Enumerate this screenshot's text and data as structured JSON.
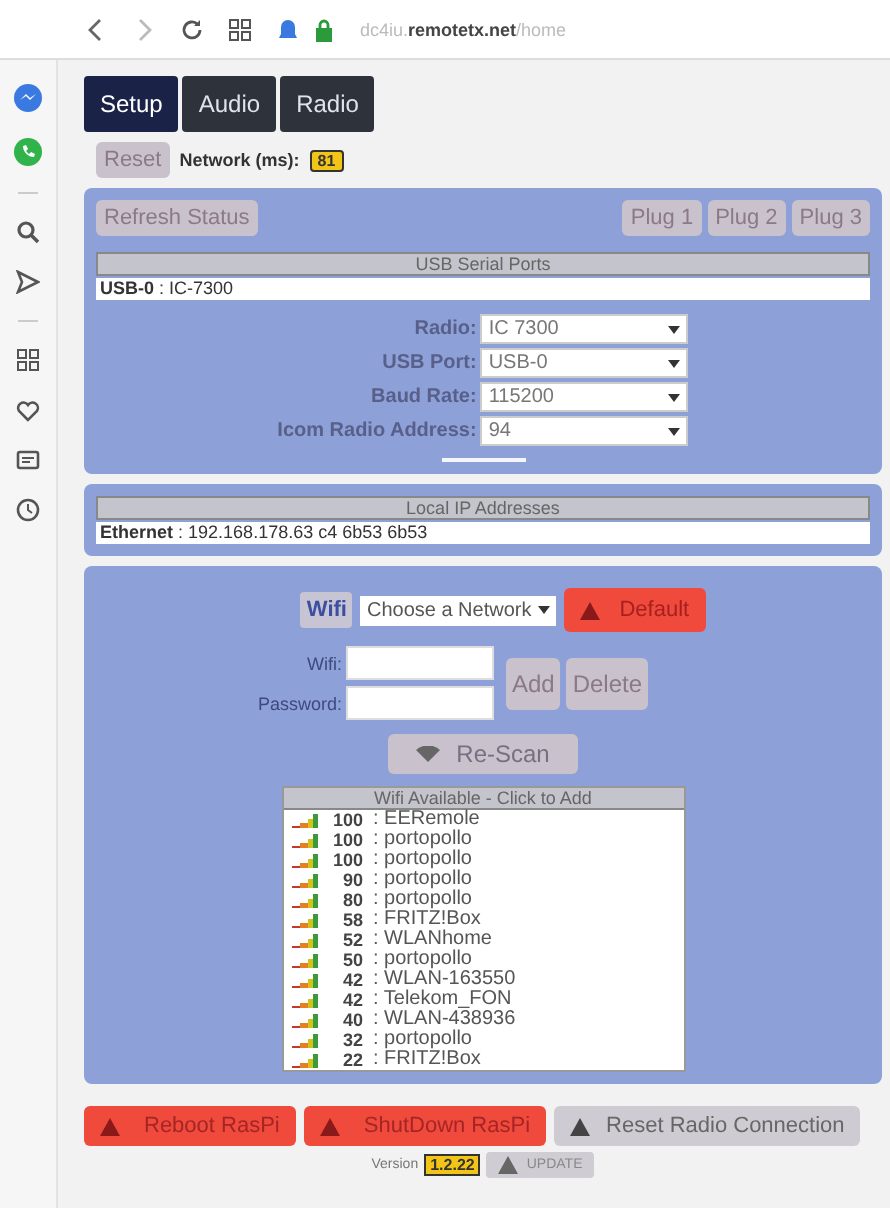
{
  "browser": {
    "url_host": "dc4iu.",
    "url_domain": "remotetx.net",
    "url_path": "/home"
  },
  "tabs": [
    {
      "label": "Setup",
      "selected": true
    },
    {
      "label": "Audio",
      "selected": false
    },
    {
      "label": "Radio",
      "selected": false
    }
  ],
  "status": {
    "reset": "Reset",
    "network_label": "Network (ms):",
    "network_value": "81"
  },
  "ports_panel": {
    "refresh": "Refresh Status",
    "plugs": [
      "Plug 1",
      "Plug 2",
      "Plug 3"
    ],
    "usb_title": "USB Serial Ports",
    "usb_ports": [
      {
        "port": "USB-0",
        "device": ": IC-7300"
      }
    ],
    "fields": [
      {
        "label": "Radio:",
        "value": "IC 7300"
      },
      {
        "label": "USB Port:",
        "value": "USB-0"
      },
      {
        "label": "Baud Rate:",
        "value": "115200"
      },
      {
        "label": "Icom Radio Address:",
        "value": "94"
      }
    ]
  },
  "ip_panel": {
    "title": "Local IP Addresses",
    "rows": [
      {
        "iface": "Ethernet",
        "address": ": 192.168.178.63 c4 6b53 6b53"
      }
    ]
  },
  "wifi_panel": {
    "label": "Wifi",
    "select": "Choose a Network",
    "default": "Default",
    "ssid_label": "Wifi:",
    "password_label": "Password:",
    "add": "Add",
    "delete": "Delete",
    "rescan": "Re-Scan",
    "list_title": "Wifi Available - Click to Add",
    "networks": [
      {
        "strength": "100",
        "name": ": EERemole"
      },
      {
        "strength": "100",
        "name": ": portopollo"
      },
      {
        "strength": "100",
        "name": ": portopollo"
      },
      {
        "strength": "90",
        "name": ": portopollo"
      },
      {
        "strength": "80",
        "name": ": portopollo"
      },
      {
        "strength": "58",
        "name": ": FRITZ!Box"
      },
      {
        "strength": "52",
        "name": ": WLANhome"
      },
      {
        "strength": "50",
        "name": ": portopollo"
      },
      {
        "strength": "42",
        "name": ": WLAN-163550"
      },
      {
        "strength": "42",
        "name": ": Telekom_FON"
      },
      {
        "strength": "40",
        "name": ": WLAN-438936"
      },
      {
        "strength": "32",
        "name": ": portopollo"
      },
      {
        "strength": "22",
        "name": ": FRITZ!Box"
      }
    ]
  },
  "footer": {
    "buttons": [
      {
        "label": "Reboot RasPi",
        "kind": "danger"
      },
      {
        "label": "ShutDown RasPi",
        "kind": "danger"
      },
      {
        "label": "Reset Radio Connection",
        "kind": "neutral"
      }
    ],
    "version_label": "Version",
    "version": "1.2.22",
    "update": "UPDATE"
  }
}
